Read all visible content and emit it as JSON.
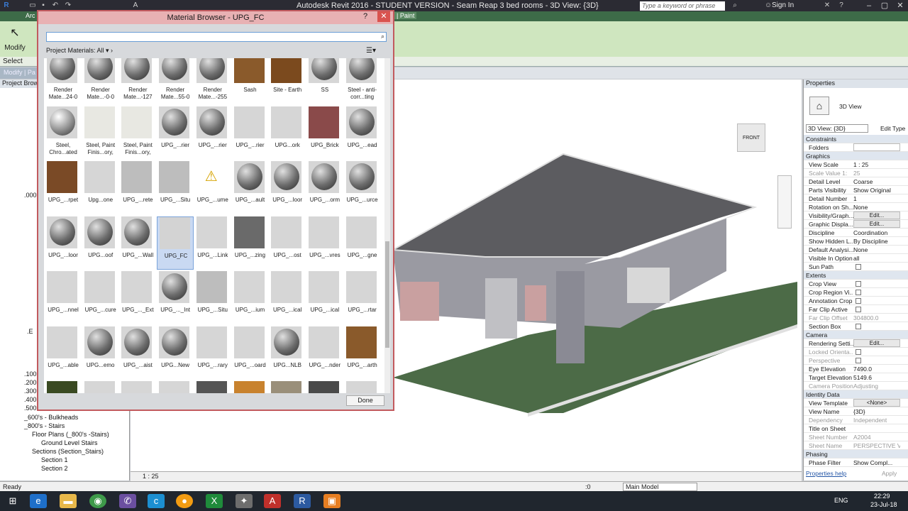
{
  "window": {
    "title": "Autodesk Revit 2016 - STUDENT VERSION -     Seam Reap 3 bed rooms - 3D View: {3D}",
    "search_placeholder": "Type a keyword or phrase",
    "sign_in": "Sign In"
  },
  "ribbon": {
    "tab_arch": "Arc",
    "modify": "Modify",
    "select": "Select",
    "paint": "Paint",
    "modify_bar": "Modify | Pa"
  },
  "browser": {
    "title": "Project Brows",
    "items": [
      ".000",
      ".E",
      ".100",
      ".200",
      ".300",
      ".400",
      ".500",
      "_600's - Bulkheads",
      "_800's - Stairs",
      "Floor Plans (_800's -Stairs)",
      "Ground Level Stairs",
      "Sections (Section_Stairs)",
      "Section 1",
      "Section 2"
    ]
  },
  "material_browser": {
    "title": "Material Browser - UPG_FC",
    "filter": "Project Materials: All",
    "done": "Done",
    "tiles": [
      {
        "label": "Render Mate...24-0",
        "kind": "sphere"
      },
      {
        "label": "Render Mate...-0-0",
        "kind": "sphere"
      },
      {
        "label": "Render Mate...-127",
        "kind": "sphere"
      },
      {
        "label": "Render Mate...55-0",
        "kind": "sphere"
      },
      {
        "label": "Render Mate...-255",
        "kind": "sphere"
      },
      {
        "label": "Sash",
        "kind": "wood"
      },
      {
        "label": "Site - Earth",
        "kind": "earth"
      },
      {
        "label": "SS",
        "kind": "sphere"
      },
      {
        "label": "Steel - anti-corr...ting",
        "kind": "sphere"
      },
      {
        "label": "Steel, Chro...ated",
        "kind": "chrome"
      },
      {
        "label": "Steel, Paint Finis...ory,",
        "kind": "white"
      },
      {
        "label": "Steel, Paint Finis...ory,",
        "kind": "white"
      },
      {
        "label": "UPG_...rier",
        "kind": "sphere"
      },
      {
        "label": "UPG_...rier",
        "kind": "sphere"
      },
      {
        "label": "UPG_...rier",
        "kind": "blank"
      },
      {
        "label": "UPG...ork",
        "kind": "blank"
      },
      {
        "label": "UPG_Brick",
        "kind": "brick"
      },
      {
        "label": "UPG_...ead",
        "kind": "sphere"
      },
      {
        "label": "UPG_...rpet",
        "kind": "carpet"
      },
      {
        "label": "Upg...one",
        "kind": "blank"
      },
      {
        "label": "UPG_...rete",
        "kind": "cube"
      },
      {
        "label": "UPG_...Situ",
        "kind": "cube"
      },
      {
        "label": "UPG_...ume",
        "kind": "warn"
      },
      {
        "label": "UPG_...ault",
        "kind": "sphere"
      },
      {
        "label": "UPG_...loor",
        "kind": "sphere"
      },
      {
        "label": "UPG_...orm",
        "kind": "sphere"
      },
      {
        "label": "UPG_...urce",
        "kind": "sphere"
      },
      {
        "label": "UPG_...loor",
        "kind": "sphere"
      },
      {
        "label": "UPG...oof",
        "kind": "sphere"
      },
      {
        "label": "UPG_...Wall",
        "kind": "sphere"
      },
      {
        "label": "UPG_FC",
        "kind": "selected"
      },
      {
        "label": "UPG_...Link",
        "kind": "blank"
      },
      {
        "label": "UPG_...zing",
        "kind": "glazing"
      },
      {
        "label": "UPG_...ost",
        "kind": "blank"
      },
      {
        "label": "UPG_...vres",
        "kind": "blank"
      },
      {
        "label": "UPG_...gne",
        "kind": "blank"
      },
      {
        "label": "UPG_...nnel",
        "kind": "blank"
      },
      {
        "label": "UPG_...cure",
        "kind": "blank"
      },
      {
        "label": "UPG_..._Ext",
        "kind": "blank"
      },
      {
        "label": "UPG_..._Int",
        "kind": "sphere"
      },
      {
        "label": "UPG_...Situ",
        "kind": "cube"
      },
      {
        "label": "UPG_...ium",
        "kind": "blank"
      },
      {
        "label": "UPG_...ical",
        "kind": "blank"
      },
      {
        "label": "UPG_...ical",
        "kind": "blank"
      },
      {
        "label": "UPG_...rtar",
        "kind": "blank"
      },
      {
        "label": "UPG_...able",
        "kind": "blank"
      },
      {
        "label": "UPG...emo",
        "kind": "sphere"
      },
      {
        "label": "UPG_...aist",
        "kind": "sphere"
      },
      {
        "label": "UPG...New",
        "kind": "sphere"
      },
      {
        "label": "UPG_...rary",
        "kind": "blank"
      },
      {
        "label": "UPG_...oard",
        "kind": "blank"
      },
      {
        "label": "UPG...NLB",
        "kind": "sphere"
      },
      {
        "label": "UPG_...nder",
        "kind": "blank"
      },
      {
        "label": "UPG_...arth",
        "kind": "wood"
      },
      {
        "label": "",
        "kind": "grass"
      },
      {
        "label": "",
        "kind": "blank"
      },
      {
        "label": "",
        "kind": "blank"
      },
      {
        "label": "",
        "kind": "blank"
      },
      {
        "label": "",
        "kind": "mesh"
      },
      {
        "label": "",
        "kind": "tiles"
      },
      {
        "label": "",
        "kind": "stone"
      },
      {
        "label": "",
        "kind": "darkcube"
      },
      {
        "label": "",
        "kind": "blank"
      }
    ]
  },
  "viewport": {
    "scale": "1 : 25",
    "viewcube": "FRONT"
  },
  "properties": {
    "title": "Properties",
    "type": "3D View",
    "selector": "3D View: {3D}",
    "edit_type": "Edit Type",
    "rows": [
      {
        "k": "Constraints",
        "v": "",
        "t": "sec"
      },
      {
        "k": "Folders",
        "v": "",
        "t": "input"
      },
      {
        "k": "Graphics",
        "v": "",
        "t": "sec"
      },
      {
        "k": "View Scale",
        "v": "1 : 25"
      },
      {
        "k": "Scale Value    1:",
        "v": "25",
        "t": "dim"
      },
      {
        "k": "Detail Level",
        "v": "Coarse"
      },
      {
        "k": "Parts Visibility",
        "v": "Show Original"
      },
      {
        "k": "Detail Number",
        "v": "1"
      },
      {
        "k": "Rotation on Sh...",
        "v": "None"
      },
      {
        "k": "Visibility/Graph...",
        "v": "Edit...",
        "t": "btn"
      },
      {
        "k": "Graphic Displa...",
        "v": "Edit...",
        "t": "btn"
      },
      {
        "k": "Discipline",
        "v": "Coordination"
      },
      {
        "k": "Show Hidden L...",
        "v": "By Discipline"
      },
      {
        "k": "Default Analysi...",
        "v": "None"
      },
      {
        "k": "Visible In Option",
        "v": "all"
      },
      {
        "k": "Sun Path",
        "v": "",
        "t": "cb"
      },
      {
        "k": "Extents",
        "v": "",
        "t": "sec"
      },
      {
        "k": "Crop View",
        "v": "",
        "t": "cb"
      },
      {
        "k": "Crop Region Vi...",
        "v": "",
        "t": "cb"
      },
      {
        "k": "Annotation Crop",
        "v": "",
        "t": "cb"
      },
      {
        "k": "Far Clip Active",
        "v": "",
        "t": "cb"
      },
      {
        "k": "Far Clip Offset",
        "v": "304800.0",
        "t": "dim"
      },
      {
        "k": "Section Box",
        "v": "",
        "t": "cb"
      },
      {
        "k": "Camera",
        "v": "",
        "t": "sec"
      },
      {
        "k": "Rendering Setti...",
        "v": "Edit...",
        "t": "btn"
      },
      {
        "k": "Locked Orienta...",
        "v": "",
        "t": "dimcb"
      },
      {
        "k": "Perspective",
        "v": "",
        "t": "dimcb"
      },
      {
        "k": "Eye Elevation",
        "v": "7490.0"
      },
      {
        "k": "Target Elevation",
        "v": "5149.6"
      },
      {
        "k": "Camera Position",
        "v": "Adjusting",
        "t": "dim"
      },
      {
        "k": "Identity Data",
        "v": "",
        "t": "sec"
      },
      {
        "k": "View Template",
        "v": "<None>",
        "t": "btn"
      },
      {
        "k": "View Name",
        "v": "{3D}"
      },
      {
        "k": "Dependency",
        "v": "Independent",
        "t": "dim"
      },
      {
        "k": "Title on Sheet",
        "v": ""
      },
      {
        "k": "Sheet Number",
        "v": "A2004",
        "t": "dim"
      },
      {
        "k": "Sheet Name",
        "v": "PERSPECTIVE VI...",
        "t": "dim"
      },
      {
        "k": "Phasing",
        "v": "",
        "t": "sec"
      },
      {
        "k": "Phase Filter",
        "v": "Show Compl..."
      }
    ],
    "help": "Properties help",
    "apply": "Apply"
  },
  "status": {
    "ready": "Ready",
    "zero": ":0",
    "model": "Main Model"
  },
  "taskbar": {
    "time": "22:29",
    "date": "23-Jul-18",
    "lang": "ENG"
  }
}
